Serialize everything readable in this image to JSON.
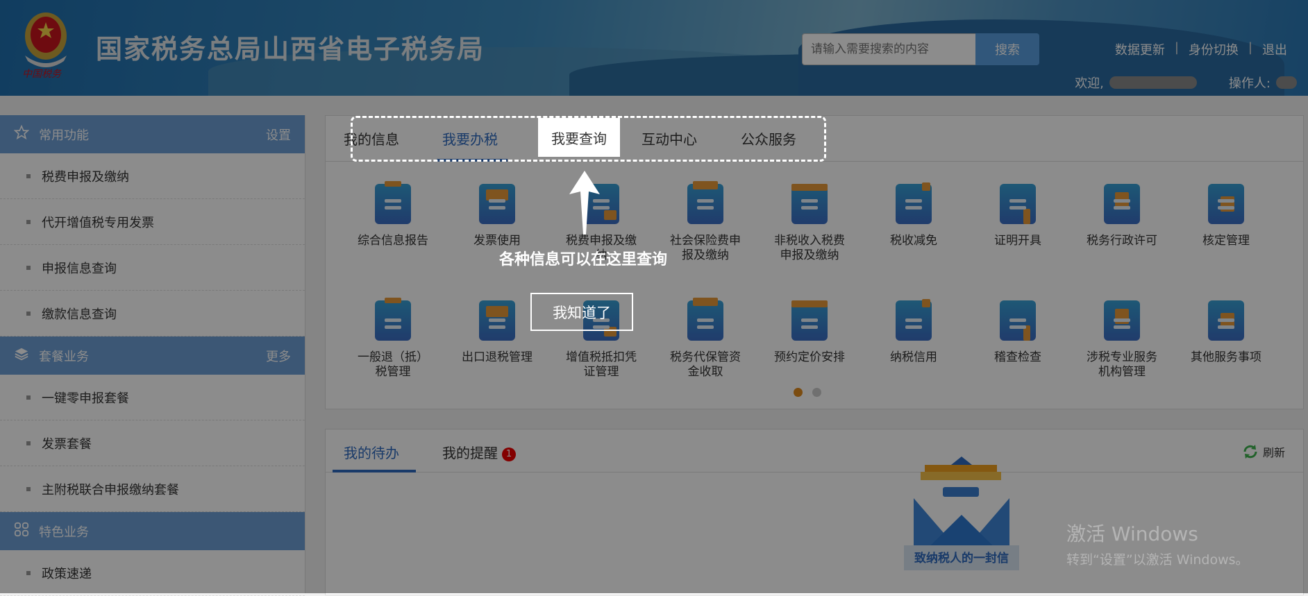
{
  "header": {
    "title": "国家税务总局山西省电子税务局",
    "emblem_text": "中国税务",
    "search": {
      "placeholder": "请输入需要搜索的内容",
      "button": "搜索"
    },
    "links": [
      "数据更新",
      "身份切换",
      "退出"
    ],
    "welcome_label": "欢迎,",
    "operator_label": "操作人:"
  },
  "sidebar": {
    "sections": [
      {
        "title": "常用功能",
        "icon": "star-icon",
        "action": "设置",
        "items": [
          "税费申报及缴纳",
          "代开增值税专用发票",
          "申报信息查询",
          "缴款信息查询"
        ]
      },
      {
        "title": "套餐业务",
        "icon": "layers-icon",
        "action": "更多",
        "items": [
          "一键零申报套餐",
          "发票套餐",
          "主附税联合申报缴纳套餐"
        ]
      },
      {
        "title": "特色业务",
        "icon": "grid-icon",
        "action": "",
        "items": [
          "政策速递"
        ]
      }
    ]
  },
  "main": {
    "tabs": [
      "我的信息",
      "我要办税",
      "我要查询",
      "互动中心",
      "公众服务"
    ],
    "active_tab": "我要办税",
    "services": [
      [
        "综合信息报告"
      ],
      [
        "发票使用"
      ],
      [
        "税费申报及缴",
        "纳"
      ],
      [
        "社会保险费申",
        "报及缴纳"
      ],
      [
        "非税收入税费",
        "申报及缴纳"
      ],
      [
        "税收减免"
      ],
      [
        "证明开具"
      ],
      [
        "税务行政许可"
      ],
      [
        "核定管理"
      ],
      [
        "一般退（抵）",
        "税管理"
      ],
      [
        "出口退税管理"
      ],
      [
        "增值税抵扣凭",
        "证管理"
      ],
      [
        "税务代保管资",
        "金收取"
      ],
      [
        "预约定价安排"
      ],
      [
        "纳税信用"
      ],
      [
        "稽查检查"
      ],
      [
        "涉税专业服务",
        "机构管理"
      ],
      [
        "其他服务事项"
      ]
    ],
    "pager": {
      "pages": 2,
      "current": 1
    },
    "colors": {
      "accent": "#2f6bc0",
      "icon_orange": "#e89a3a",
      "pager_active": "#e08a1e"
    }
  },
  "todo": {
    "tabs": [
      "我的待办",
      "我的提醒"
    ],
    "reminder_badge": "1",
    "refresh": "刷新",
    "letter_caption": "致纳税人的一封信"
  },
  "guide": {
    "highlight_tab": "我要查询",
    "text": "各种信息可以在这里查询",
    "button": "我知道了"
  },
  "watermark": {
    "line1": "激活 Windows",
    "line2": "转到“设置”以激活 Windows。"
  }
}
